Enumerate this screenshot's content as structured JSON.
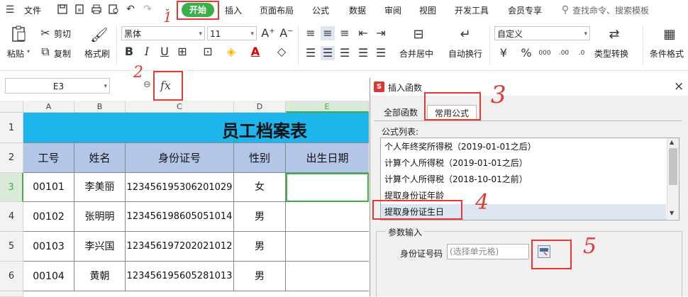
{
  "menubar": {
    "app_menu": "文件",
    "tabs": [
      "开始",
      "插入",
      "页面布局",
      "公式",
      "数据",
      "审阅",
      "视图",
      "开发工具",
      "会员专享"
    ],
    "search_placeholder": "查找命令、搜索模板"
  },
  "ribbon": {
    "paste": "粘贴",
    "cut": "剪切",
    "copy": "复制",
    "format_painter": "格式刷",
    "font_name": "黑体",
    "font_size": "11",
    "merge_center": "合并居中",
    "wrap_text": "自动换行",
    "number_format": "自定义",
    "type_convert": "类型转换",
    "cond_format": "条件格式"
  },
  "formula_bar": {
    "name_box": "E3",
    "fx_label": "fx"
  },
  "sheet": {
    "columns": [
      "A",
      "B",
      "C",
      "D",
      "E"
    ],
    "rows": [
      "1",
      "2",
      "3",
      "4",
      "5",
      "6"
    ],
    "title": "员工档案表",
    "headers": [
      "工号",
      "姓名",
      "身份证号",
      "性别",
      "出生日期"
    ],
    "data": [
      [
        "00101",
        "李美丽",
        "123456195306201029",
        "女",
        ""
      ],
      [
        "00102",
        "张明明",
        "123456198605051014",
        "男",
        ""
      ],
      [
        "00103",
        "李兴国",
        "123456197202021012",
        "男",
        ""
      ],
      [
        "00104",
        "黄朝",
        "123456195605281013",
        "男",
        ""
      ]
    ]
  },
  "dialog": {
    "title": "插入函数",
    "close": "×",
    "tabs": [
      "全部函数",
      "常用公式"
    ],
    "list_label": "公式列表:",
    "formulas": [
      "个人年终奖所得税（2019-01-01之后）",
      "计算个人所得税（2019-01-01之后）",
      "计算个人所得税（2018-10-01之前）",
      "提取身份证年龄",
      "提取身份证生日"
    ],
    "params_group": "参数输入",
    "param_label": "身份证号码",
    "param_placeholder": "(选择单元格)"
  },
  "annotations": [
    "1",
    "2",
    "3",
    "4",
    "5"
  ],
  "colors": {
    "start_tab": "#3cae4a",
    "header_fill": "#b4c6e7",
    "title_fill": "#1eb4ec",
    "annotation_red": "#e53935",
    "selection_green": "#3cae4a"
  }
}
